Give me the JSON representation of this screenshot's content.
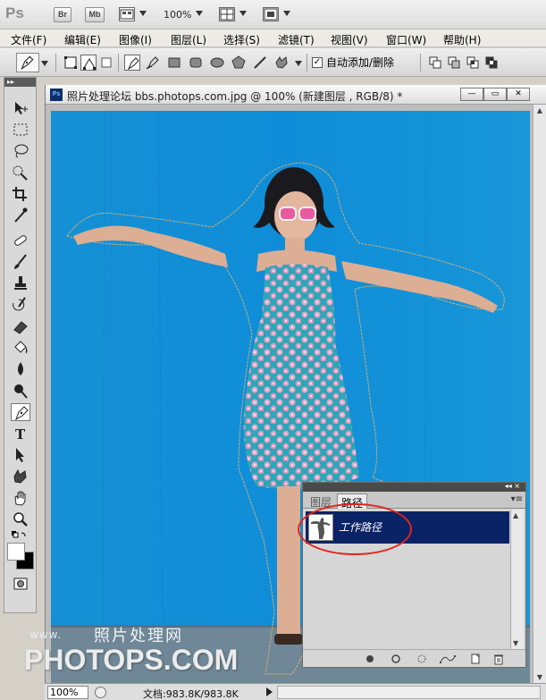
{
  "appbar": {
    "logo": "Ps",
    "bridge_label": "Br",
    "minibridge_label": "Mb",
    "zoom": "100%"
  },
  "menu": [
    {
      "label": "文件(F)"
    },
    {
      "label": "编辑(E)"
    },
    {
      "label": "图像(I)"
    },
    {
      "label": "图层(L)"
    },
    {
      "label": "选择(S)"
    },
    {
      "label": "滤镜(T)"
    },
    {
      "label": "视图(V)"
    },
    {
      "label": "窗口(W)"
    },
    {
      "label": "帮助(H)"
    }
  ],
  "options": {
    "auto_add_delete": "自动添加/删除",
    "auto_add_checked": true
  },
  "document": {
    "title": "照片处理论坛 bbs.photops.com.jpg @ 100% (新建图层 , RGB/8) *",
    "ps_badge": "Ps"
  },
  "status": {
    "zoom": "100%",
    "doc_info": "文档:983.8K/983.8K"
  },
  "watermark": {
    "line1": "www.",
    "line2": "照片处理网",
    "line3": "PHOTOPS.COM"
  },
  "panel": {
    "tabs": [
      {
        "label": "图层"
      },
      {
        "label": "路径"
      }
    ],
    "active_tab": "路径",
    "path_name": "工作路径",
    "menu_icon": "▾≡",
    "collapse": "◂◂ ×"
  },
  "colors": {
    "canvas_blue": "#0f8fd6",
    "path_highlight": "#0a2266",
    "annotation_red": "#e0261c"
  }
}
